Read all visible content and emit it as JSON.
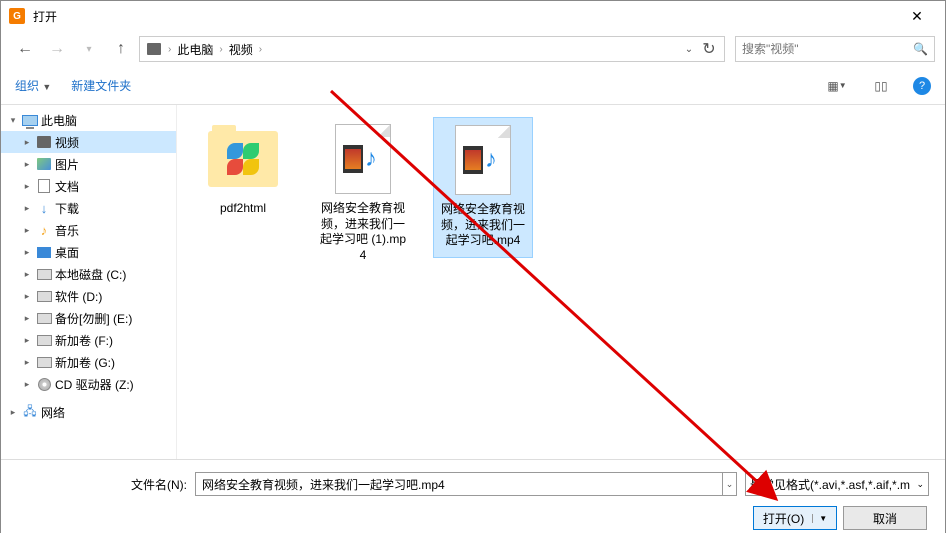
{
  "window": {
    "title": "打开"
  },
  "nav": {
    "path_root": "此电脑",
    "path_seg1": "视频",
    "search_placeholder": "搜索\"视频\""
  },
  "toolbar": {
    "organize": "组织",
    "new_folder": "新建文件夹"
  },
  "sidebar": {
    "pc": "此电脑",
    "videos": "视频",
    "pictures": "图片",
    "documents": "文档",
    "downloads": "下载",
    "music": "音乐",
    "desktop": "桌面",
    "drive_c": "本地磁盘 (C:)",
    "drive_d": "软件 (D:)",
    "drive_e": "备份[勿删] (E:)",
    "drive_f": "新加卷 (F:)",
    "drive_g": "新加卷 (G:)",
    "drive_z": "CD 驱动器 (Z:)",
    "network": "网络"
  },
  "files": {
    "f1": "pdf2html",
    "f2": "网络安全教育视频，进来我们一起学习吧 (1).mp4",
    "f3": "网络安全教育视频，进来我们一起学习吧.mp4"
  },
  "footer": {
    "filename_label": "文件名(N):",
    "filename_value": "网络安全教育视频，进来我们一起学习吧.mp4",
    "filter": "最常见格式(*.avi,*.asf,*.aif,*.m",
    "open_btn": "打开(O)",
    "cancel_btn": "取消"
  }
}
